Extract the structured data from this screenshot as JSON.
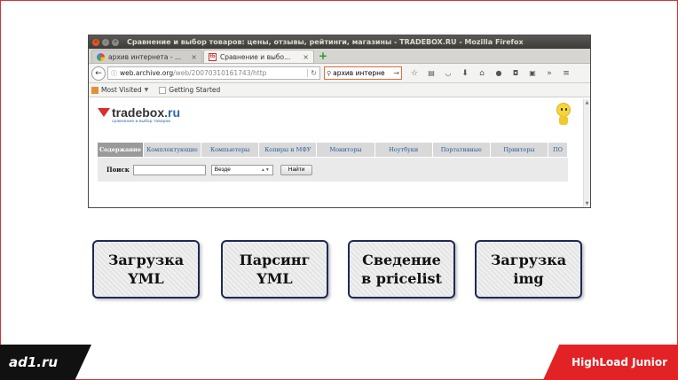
{
  "window": {
    "title": "Сравнение и выбор товаров: цены, отзывы, рейтинги, магазины - TRADEBOX.RU - Mozilla Firefox"
  },
  "tabs": [
    {
      "label": "архив интернета - ...",
      "favicon": "google-icon"
    },
    {
      "label": "Сравнение и выбо...",
      "favicon": "tradebox-icon",
      "favicon_text": "tb"
    }
  ],
  "navbar": {
    "url_domain": "web.archive.org",
    "url_path": "/web/20070310161743/http",
    "search_value": "архив интерне"
  },
  "bookmarks": [
    {
      "label": "Most Visited"
    },
    {
      "label": "Getting Started"
    }
  ],
  "site": {
    "logo_name": "tradebox",
    "logo_domain": ".ru",
    "tagline": "сравнение и выбор товаров",
    "nav": [
      "Содержание",
      "Комплектующие",
      "Компьютеры",
      "Копиры и МФУ",
      "Мониторы",
      "Ноутбуки",
      "Портативные",
      "Принтеры",
      "ПО"
    ],
    "search_label": "Поиск",
    "search_scope": "Везде",
    "search_button": "Найти"
  },
  "steps": [
    {
      "line1": "Загрузка",
      "line2": "YML"
    },
    {
      "line1": "Парсинг",
      "line2": "YML"
    },
    {
      "line1": "Сведение",
      "line2": "в pricelist"
    },
    {
      "line1": "Загрузка",
      "line2": "img"
    }
  ],
  "footer": {
    "left_logo": "ad1.ru",
    "right_logo": "HighLoad Junior"
  },
  "colors": {
    "accent_red": "#e32226",
    "box_border": "#1e2a55"
  }
}
